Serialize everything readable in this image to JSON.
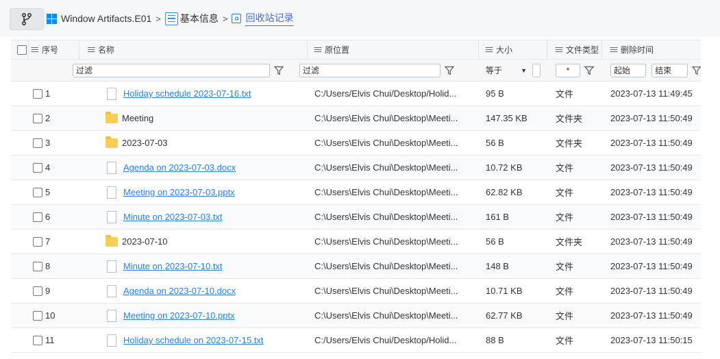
{
  "breadcrumb": {
    "items": [
      {
        "label": "Window Artifacts.E01",
        "icon": "windows-logo-icon"
      },
      {
        "label": "基本信息",
        "icon": "info-list-icon"
      },
      {
        "label": "回收站记录",
        "icon": "recycle-bin-icon"
      }
    ],
    "separator": ">"
  },
  "columns": {
    "index": "序号",
    "name": "名称",
    "location": "原位置",
    "size": "大小",
    "type": "文件类型",
    "deleted_time": "删除时间"
  },
  "filters": {
    "name_placeholder": "过滤",
    "location_placeholder": "过滤",
    "size_operator": "等于",
    "type_value": "*",
    "time_start": "起始",
    "time_end": "结束"
  },
  "rows": [
    {
      "index": "1",
      "name": "Holiday schedule 2023-07-16.txt",
      "kind": "file",
      "location": "C:/Users/Elvis Chui/Desktop/Holid...",
      "size": "95 B",
      "type": "文件",
      "time": "2023-07-13 11:49:45"
    },
    {
      "index": "2",
      "name": "Meeting",
      "kind": "folder",
      "location": "C:\\Users\\Elvis Chui\\Desktop\\Meeti...",
      "size": "147.35 KB",
      "type": "文件夹",
      "time": "2023-07-13 11:50:49"
    },
    {
      "index": "3",
      "name": "2023-07-03",
      "kind": "folder",
      "location": "C:\\Users\\Elvis Chui\\Desktop\\Meeti...",
      "size": "56 B",
      "type": "文件夹",
      "time": "2023-07-13 11:50:49"
    },
    {
      "index": "4",
      "name": "Agenda on 2023-07-03.docx",
      "kind": "file",
      "location": "C:\\Users\\Elvis Chui\\Desktop\\Meeti...",
      "size": "10.72 KB",
      "type": "文件",
      "time": "2023-07-13 11:50:49"
    },
    {
      "index": "5",
      "name": "Meeting on 2023-07-03.pptx",
      "kind": "file",
      "location": "C:\\Users\\Elvis Chui\\Desktop\\Meeti...",
      "size": "62.82 KB",
      "type": "文件",
      "time": "2023-07-13 11:50:49"
    },
    {
      "index": "6",
      "name": "Minute on 2023-07-03.txt",
      "kind": "file",
      "location": "C:\\Users\\Elvis Chui\\Desktop\\Meeti...",
      "size": "161 B",
      "type": "文件",
      "time": "2023-07-13 11:50:49"
    },
    {
      "index": "7",
      "name": "2023-07-10",
      "kind": "folder",
      "location": "C:\\Users\\Elvis Chui\\Desktop\\Meeti...",
      "size": "56 B",
      "type": "文件夹",
      "time": "2023-07-13 11:50:49"
    },
    {
      "index": "8",
      "name": "Minute on 2023-07-10.txt",
      "kind": "file",
      "location": "C:\\Users\\Elvis Chui\\Desktop\\Meeti...",
      "size": "148 B",
      "type": "文件",
      "time": "2023-07-13 11:50:49"
    },
    {
      "index": "9",
      "name": "Agenda on 2023-07-10.docx",
      "kind": "file",
      "location": "C:\\Users\\Elvis Chui\\Desktop\\Meeti...",
      "size": "10.71 KB",
      "type": "文件",
      "time": "2023-07-13 11:50:49"
    },
    {
      "index": "10",
      "name": "Meeting on 2023-07-10.pptx",
      "kind": "file",
      "location": "C:\\Users\\Elvis Chui\\Desktop\\Meeti...",
      "size": "62.77 KB",
      "type": "文件",
      "time": "2023-07-13 11:50:49"
    },
    {
      "index": "11",
      "name": "Holiday schedule on 2023-07-15.txt",
      "kind": "file",
      "location": "C:/Users/Elvis Chui/Desktop/Holid...",
      "size": "88 B",
      "type": "文件",
      "time": "2023-07-13 11:50:15"
    }
  ],
  "colors": {
    "link": "#2f7fd8",
    "folder": "#f7cf56",
    "header_bg": "#f6f7f9",
    "active_crumb": "#4b6cd6"
  }
}
